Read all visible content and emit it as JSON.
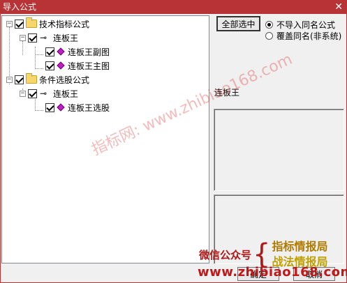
{
  "window": {
    "title": "导入公式",
    "close_glyph": "✕"
  },
  "tree": {
    "groups": [
      {
        "label": "技术指标公式",
        "children": [
          {
            "label": "连板王",
            "children": [
              {
                "label": "连板王副图"
              },
              {
                "label": "连板王主图"
              }
            ]
          }
        ]
      },
      {
        "label": "条件选股公式",
        "children": [
          {
            "label": "连板王",
            "children": [
              {
                "label": "连板王选股"
              }
            ]
          }
        ]
      }
    ],
    "expander_glyph": "−",
    "key_glyph": "⊸"
  },
  "toolbar": {
    "select_all_label": "全部选中"
  },
  "options": [
    {
      "label": "不导入同名公式",
      "selected": true
    },
    {
      "label": "覆盖同名(非系统)",
      "selected": false
    }
  ],
  "info": {
    "selected_name": "连板王"
  },
  "footer": {
    "ok_label": "确定",
    "cancel_label": "取消"
  },
  "watermark": {
    "diagonal": "指标网: www.zhibiao168.com",
    "wechat_label": "微信公众号",
    "brace": "{",
    "line1": "指标情报局",
    "line2": "战法情报局",
    "url": "www.zhibiao168.com"
  },
  "colors": {
    "titlebar": "#b83336",
    "diamond": "#c020c0",
    "folder": "#f5d76e"
  }
}
